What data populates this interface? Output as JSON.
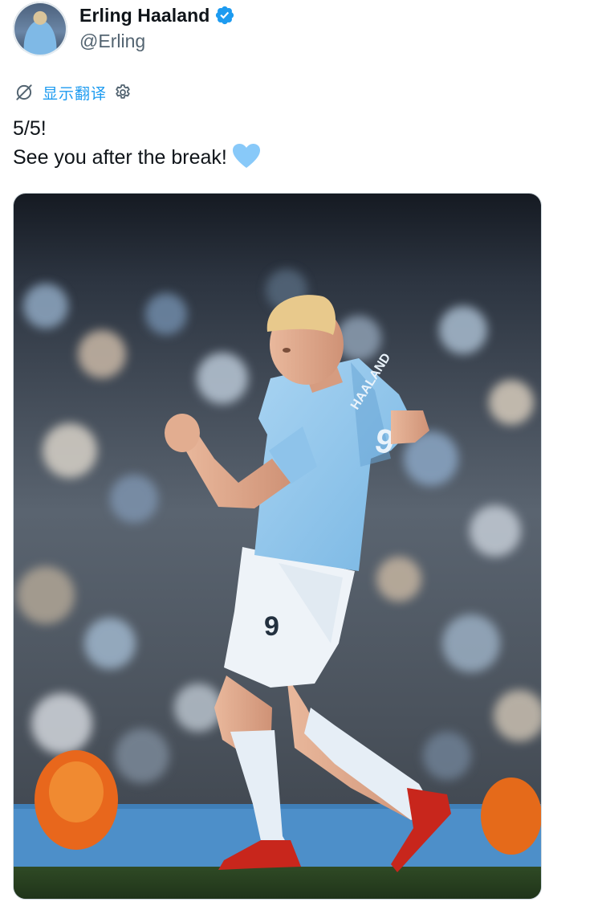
{
  "user": {
    "display_name": "Erling Haaland",
    "handle": "@Erling",
    "verified": true,
    "avatar_icon": "avatar-photo",
    "verified_color": "#1d9bf0"
  },
  "translate": {
    "label": "显示翻译",
    "left_icon": "no-translate-icon",
    "right_icon": "gear-icon",
    "color": "#1d9bf0"
  },
  "tweet": {
    "line1": "5/5!",
    "line2": "See you after the break!",
    "emoji": "light-blue-heart",
    "emoji_color": "#88c9f9"
  },
  "media": {
    "kind": "photo",
    "jersey_name": "HAALAND",
    "jersey_number": "9",
    "shorts_number": "9"
  }
}
